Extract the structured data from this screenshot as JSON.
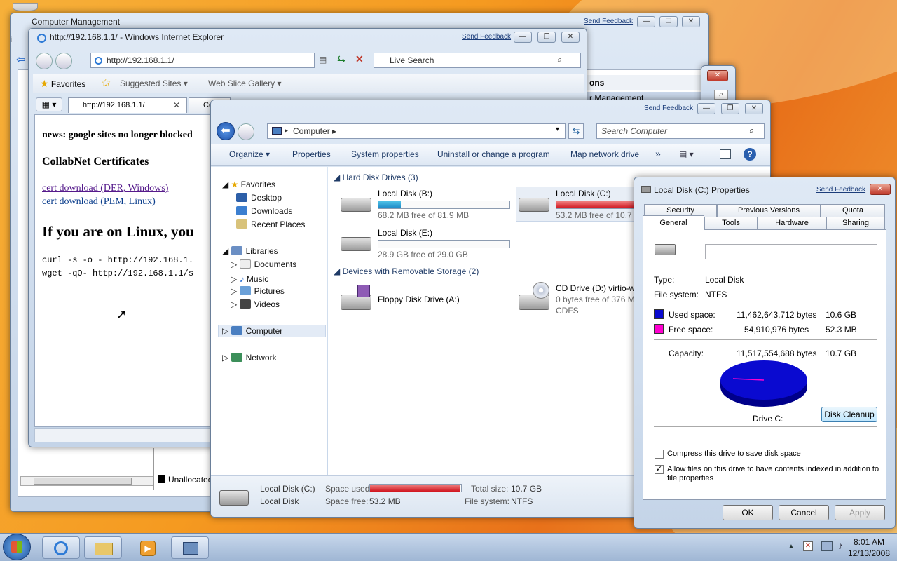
{
  "computer_mgmt": {
    "title": "Computer Management",
    "feedback": "Send Feedback",
    "unallocated": "Unallocated",
    "menu_stub": "Fi",
    "actions_label": "ons",
    "action_item": "r Management"
  },
  "ie": {
    "title": "http://192.168.1.1/ - Windows Internet Explorer",
    "feedback": "Send Feedback",
    "address": "http://192.168.1.1/",
    "search_placeholder": "Live Search",
    "favorites": "Favorites",
    "suggested": "Suggested Sites",
    "webslice": "Web Slice Gallery",
    "tab1": "http://192.168.1.1/",
    "tab2": "Ce",
    "page": {
      "news": "news: google sites no longer blocked",
      "heading": "CollabNet Certificates",
      "link1": "cert download (DER, Windows)",
      "link2": "cert download (PEM, Linux)",
      "linux_heading": "If you are on Linux, you",
      "cmd1": "curl -s -o - http://192.168.1.",
      "cmd2": "wget -qO- http://192.168.1.1/s"
    }
  },
  "explorer": {
    "feedback": "Send Feedback",
    "breadcrumb": "Computer",
    "search_placeholder": "Search Computer",
    "toolbar": [
      "Organize",
      "Properties",
      "System properties",
      "Uninstall or change a program",
      "Map network drive"
    ],
    "more": "»",
    "nav": {
      "favorites": "Favorites",
      "desktop": "Desktop",
      "downloads": "Downloads",
      "recent": "Recent Places",
      "libraries": "Libraries",
      "documents": "Documents",
      "music": "Music",
      "pictures": "Pictures",
      "videos": "Videos",
      "computer": "Computer",
      "network": "Network"
    },
    "group_hdd": "Hard Disk Drives (3)",
    "group_removable": "Devices with Removable Storage (2)",
    "drives": {
      "b": {
        "name": "Local Disk (B:)",
        "free": "68.2 MB free of 81.9 MB",
        "fill": 0.17
      },
      "c": {
        "name": "Local Disk (C:)",
        "free": "53.2 MB free of 10.7 G",
        "fill": 0.99
      },
      "e": {
        "name": "Local Disk (E:)",
        "free": "28.9 GB free of 29.0 GB",
        "fill": 0.0
      },
      "a": {
        "name": "Floppy Disk Drive (A:)"
      },
      "d": {
        "name": "CD Drive (D:) virtio-w",
        "free": "0 bytes free of 376 M",
        "fs": "CDFS"
      }
    },
    "status": {
      "name": "Local Disk (C:)",
      "type": "Local Disk",
      "used_label": "Space used:",
      "free_label": "Space free:",
      "free_value": "53.2 MB",
      "total_label": "Total size:",
      "total_value": "10.7 GB",
      "fs_label": "File system:",
      "fs_value": "NTFS"
    }
  },
  "props": {
    "title": "Local Disk (C:) Properties",
    "feedback": "Send Feedback",
    "tabs_back": [
      "Security",
      "Previous Versions",
      "Quota"
    ],
    "tabs_front": [
      "General",
      "Tools",
      "Hardware",
      "Sharing"
    ],
    "type_label": "Type:",
    "type_value": "Local Disk",
    "fs_label": "File system:",
    "fs_value": "NTFS",
    "used_label": "Used space:",
    "used_bytes": "11,462,643,712 bytes",
    "used_gb": "10.6 GB",
    "free_label": "Free space:",
    "free_bytes": "54,910,976 bytes",
    "free_gb": "52.3 MB",
    "cap_label": "Capacity:",
    "cap_bytes": "11,517,554,688 bytes",
    "cap_gb": "10.7 GB",
    "drive_label": "Drive C:",
    "cleanup": "Disk Cleanup",
    "compress": "Compress this drive to save disk space",
    "index1": "Allow files on this drive to have contents indexed in addition to",
    "index2": "file properties",
    "ok": "OK",
    "cancel": "Cancel",
    "apply": "Apply",
    "used_color": "#0a0ad0",
    "free_color": "#ff00d0"
  },
  "taskbar": {
    "time": "8:01 AM",
    "date": "12/13/2008"
  }
}
